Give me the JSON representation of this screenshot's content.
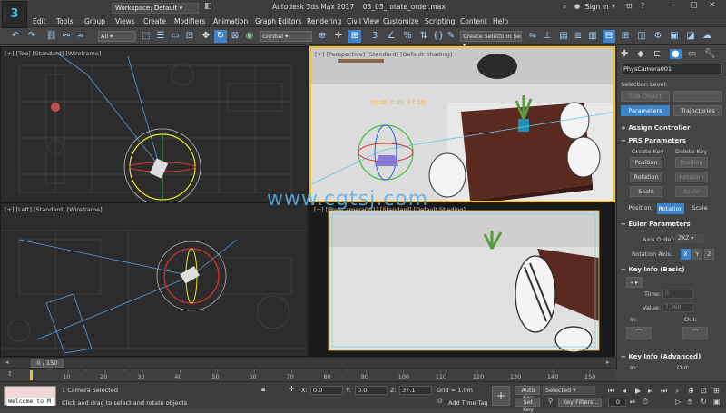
{
  "app": {
    "title": "Autodesk 3ds Max 2017",
    "file": "03_03_rotate_order.max",
    "logo": "3"
  },
  "workspace": {
    "label": "Workspace: Default"
  },
  "account": {
    "sign_in": "Sign In"
  },
  "menus": [
    "Edit",
    "Tools",
    "Group",
    "Views",
    "Create",
    "Modifiers",
    "Animation",
    "Graph Editors",
    "Rendering",
    "Civil View",
    "Customize",
    "Scripting",
    "Content",
    "Help"
  ],
  "toolbar": {
    "filter": "All",
    "coord_system": "Gimbal",
    "selection_set": "Create Selection Se"
  },
  "viewports": {
    "top": "[+] [Top] [Standard] [Wireframe]",
    "perspective": "[+] [Perspective] [Standard] [Default Shading]",
    "left": "[+] [Left] [Standard] [Wireframe]",
    "camera": "[+] [PhysCamera001] [Standard] [Default Shading]",
    "gizmo_readout": "[0.00, 0.00, 37.10]"
  },
  "watermark": "www.cgtsj.com",
  "command_panel": {
    "object_name": "PhysCamera001",
    "selection_level_label": "Selection Level:",
    "sub_object": "Sub-Object",
    "tabs": [
      "Parameters",
      "Trajectories"
    ],
    "assign_controller": "Assign Controller",
    "prs": {
      "title": "PRS Parameters",
      "create_key": "Create Key",
      "delete_key": "Delete Key",
      "buttons": [
        "Position",
        "Rotation",
        "Scale"
      ],
      "modes": [
        "Position",
        "Rotation",
        "Scale"
      ]
    },
    "euler": {
      "title": "Euler Parameters",
      "axis_order_label": "Axis Order:",
      "axis_order": "ZXZ",
      "rotation_axis_label": "Rotation Axis:",
      "axes": [
        "X",
        "Y",
        "Z"
      ]
    },
    "key_info_basic": {
      "title": "Key Info (Basic)",
      "time_label": "Time:",
      "time": "0",
      "value_label": "Value:",
      "value": "7.368",
      "in_label": "In:",
      "out_label": "Out:"
    },
    "key_info_advanced": {
      "title": "Key Info (Advanced)",
      "in_label": "In:",
      "out_label": "Out:"
    }
  },
  "timeslider": {
    "label": "0 / 150"
  },
  "trackbar": {
    "ticks": [
      "10",
      "20",
      "30",
      "40",
      "50",
      "60",
      "70",
      "80",
      "90",
      "100",
      "110",
      "120",
      "130",
      "140",
      "150"
    ]
  },
  "status": {
    "maxscript": "Welcome to M",
    "selected": "1 Camera Selected",
    "prompt": "Click and drag to select and rotate objects",
    "x_label": "X:",
    "x": "0.0",
    "y_label": "Y:",
    "y": "0.0",
    "z_label": "Z:",
    "z": "37.1",
    "grid": "Grid = 1.0m",
    "add_time_tag": "Add Time Tag",
    "auto_key": "Auto Key",
    "set_key": "Set Key",
    "selected_dropdown": "Selected",
    "key_filters": "Key Filters...",
    "frame": "0"
  },
  "colors": {
    "accent": "#3d83c8",
    "viewport_bg": "#2b2b2b",
    "active_border": "#f0c030",
    "x_axis": "#e03030",
    "y_axis": "#40c040",
    "z_axis": "#3060e0",
    "gimbal_ring": "#e8e820"
  }
}
